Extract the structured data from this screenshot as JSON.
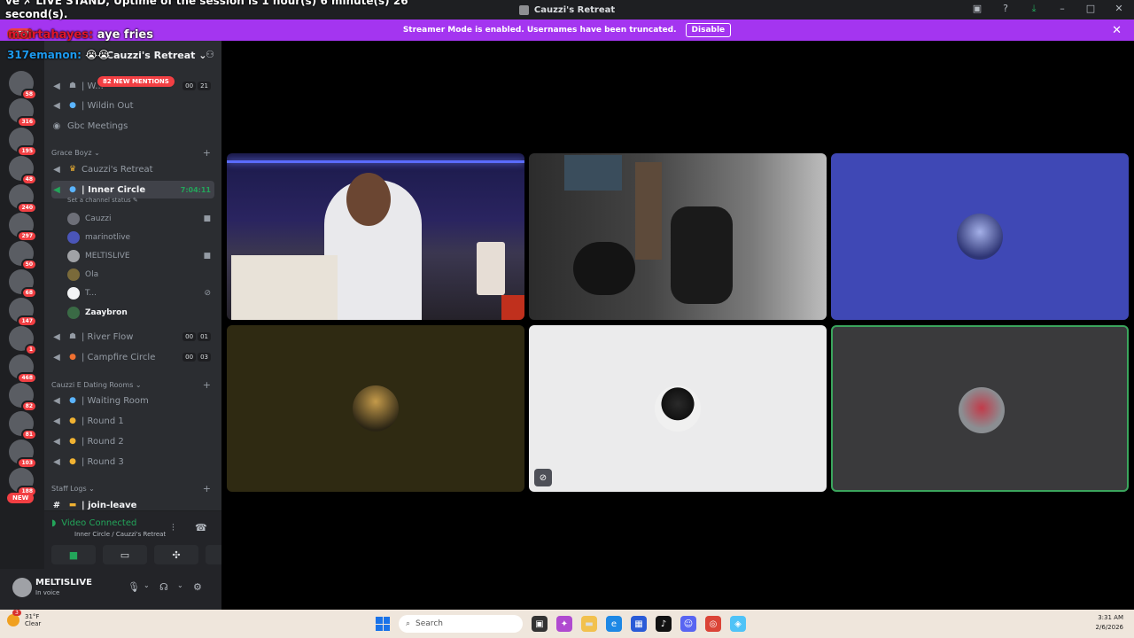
{
  "titlebar": {
    "title": "Cauzzi's Retreat"
  },
  "overlay": {
    "line1": "ve ✗ LIVE STAND, Uptime of the session is 1 hour(s) 6 minute(s) 26",
    "line2": "second(s).",
    "chat1_name": "moirtahayes:",
    "chat1_msg": "aye fries",
    "chat2_name": "317emanon:",
    "chat2_msg": "😭😭"
  },
  "banner": {
    "text": "Streamer Mode is enabled. Usernames have been truncated.",
    "button": "Disable"
  },
  "server": {
    "name": "Cauzzi's Retreat"
  },
  "mentions": "82 NEW MENTIONS",
  "guild_badges": [
    "NEW",
    "58",
    "316",
    "195",
    "48",
    "240",
    "297",
    "50",
    "68",
    "147",
    "1",
    "468",
    "82",
    "81",
    "103",
    "188",
    "NEW"
  ],
  "channels": {
    "wildin_top": {
      "label": "| W...",
      "c1": "00",
      "c2": "21"
    },
    "wildin_out": {
      "label": "| Wildin Out"
    },
    "gbc": {
      "label": "Gbc Meetings"
    },
    "cat_grace": "Grace Boyz",
    "cauzzis": {
      "label": "Cauzzi's Retreat"
    },
    "inner": {
      "label": "| Inner Circle",
      "timer": "7:04:11",
      "status": "Set a channel status"
    },
    "river": {
      "label": "| River Flow",
      "c1": "00",
      "c2": "01"
    },
    "campfire": {
      "label": "| Campfire Circle",
      "c1": "00",
      "c2": "03"
    },
    "cat_dating": "Cauzzi E Dating Rooms",
    "waiting": {
      "label": "| Waiting Room"
    },
    "round1": {
      "label": "| Round 1"
    },
    "round2": {
      "label": "| Round 2"
    },
    "round3": {
      "label": "| Round 3"
    },
    "cat_staff": "Staff Logs",
    "joinleave": {
      "label": "| join-leave"
    }
  },
  "users": [
    "Cauzzi",
    "marinotlive",
    "MELTISLIVE",
    "Ola",
    "T...",
    "Zaaybron"
  ],
  "voice": {
    "status": "Video Connected",
    "location": "Inner Circle / Cauzzi's Retreat"
  },
  "me": {
    "name": "MELTISLIVE",
    "status": "In voice"
  },
  "taskbar": {
    "temp": "31°F",
    "cond": "Clear",
    "weather_badge": "3",
    "search": "Search",
    "time": "3:31 AM",
    "date": "2/6/2026"
  },
  "colors": {
    "accent": "#a435f0",
    "green": "#23a55a",
    "red": "#f23f43",
    "blurple": "#3f48b5"
  }
}
